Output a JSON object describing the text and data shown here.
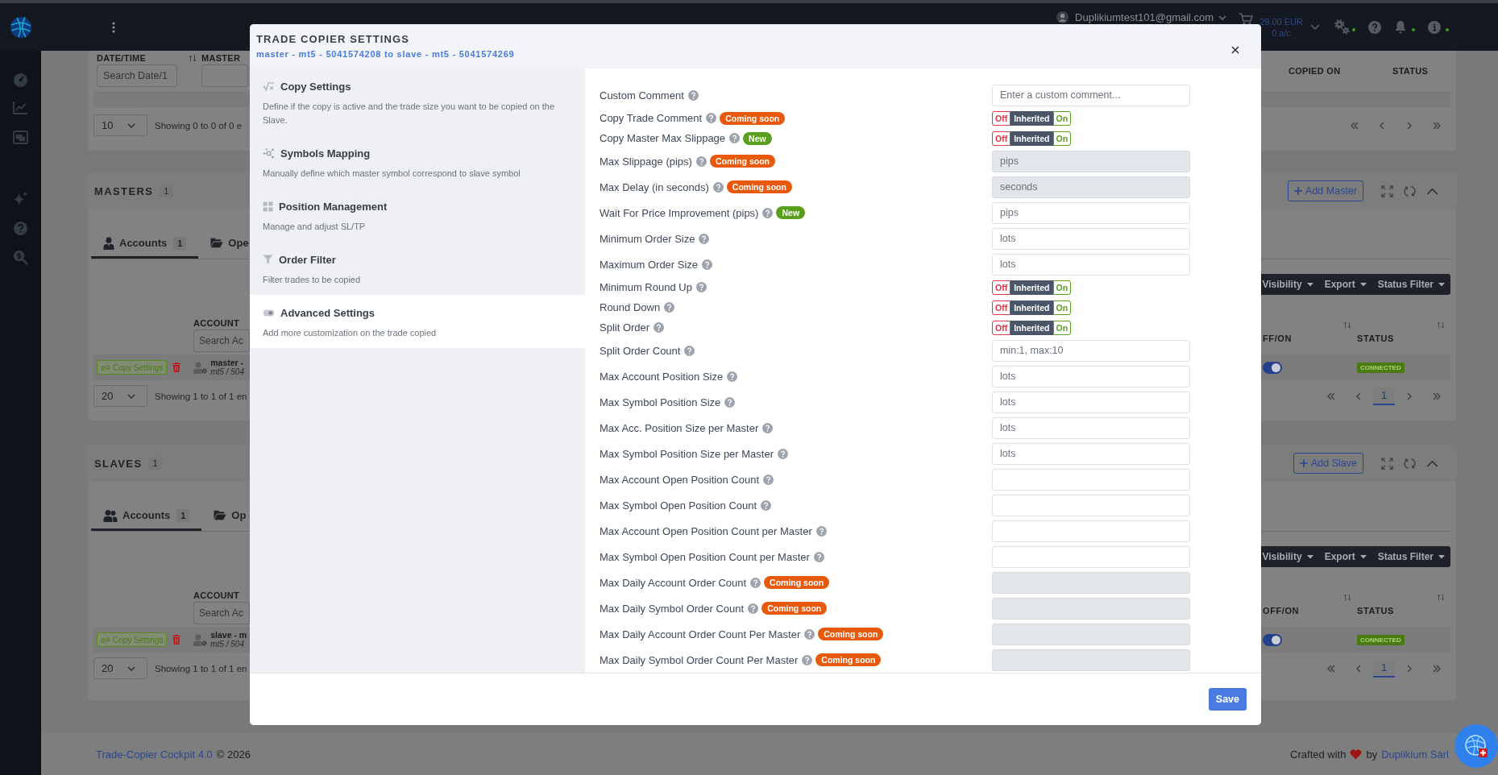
{
  "header": {
    "user_email": "Duplikiumtest101@gmail.com",
    "balance": "29.00 EUR",
    "accounts": "0 a/c"
  },
  "trades": {
    "columns": [
      {
        "label": "DATE/TIME",
        "sortable": true,
        "filter": true,
        "placeholder": "Search Date/1"
      },
      {
        "label": "MASTER",
        "sortable": false,
        "filter": true
      },
      {
        "label": "COPIED ON",
        "sortable": false,
        "filter": false
      },
      {
        "label": "STATUS",
        "sortable": false,
        "filter": false
      }
    ],
    "page_size": "10",
    "showing": "Showing 0 to 0 of 0 e"
  },
  "sections": [
    {
      "kind": "master",
      "title": "MASTERS",
      "count": "1",
      "add_button": "Add Master",
      "tabs": [
        {
          "label": "Accounts",
          "count": "1",
          "selected": true
        },
        {
          "label": "Ope",
          "selected": false
        }
      ],
      "toolbar": [
        "Visibility",
        "Export",
        "Status Filter"
      ],
      "columns": [
        {
          "label": "ACCOUNT",
          "sortable": false,
          "filter": true,
          "placeholder": "Search Ac"
        },
        {
          "label": "FF/ON",
          "sortable": true,
          "filter": false
        },
        {
          "label": "STATUS",
          "sortable": true,
          "filter": false
        }
      ],
      "rows": [
        {
          "action": "Copy Settings",
          "name": "master -",
          "detail": "mt5 / 504",
          "on": true,
          "status": "CONNECTED"
        }
      ],
      "page_size": "20",
      "showing": "Showing 1 to 1 of 1 en",
      "current_page": "1"
    },
    {
      "kind": "slave",
      "title": "SLAVES",
      "count": "1",
      "add_button": "Add Slave",
      "tabs": [
        {
          "label": "Accounts",
          "count": "1",
          "selected": true
        },
        {
          "label": "Op",
          "selected": false
        }
      ],
      "toolbar": [
        "Visibility",
        "Export",
        "Status Filter"
      ],
      "columns": [
        {
          "label": "ACCOUNT",
          "sortable": false,
          "filter": true,
          "placeholder": "Search Ac"
        },
        {
          "label": "OFF/ON",
          "sortable": true,
          "filter": false
        },
        {
          "label": "STATUS",
          "sortable": true,
          "filter": false
        }
      ],
      "rows": [
        {
          "action": "Copy Settings",
          "name": "slave - m",
          "detail": "mt5 / 504",
          "on": true,
          "status": "CONNECTED"
        }
      ],
      "page_size": "20",
      "showing": "Showing 1 to 1 of 1 en",
      "current_page": "1"
    }
  ],
  "footer": {
    "product": "Trade-Copier Cockpit 4.0",
    "copyright": "© 2026",
    "credit_prefix": "Crafted with",
    "credit_by": "by",
    "company": "Duplikium Sàrl"
  },
  "modal": {
    "title": "TRADE COPIER SETTINGS",
    "subtitle": "master - mt5 - 5041574208 to slave - mt5 - 5041574269",
    "nav": [
      {
        "title": "Copy Settings",
        "description": "Define if the copy is active and the trade size you want to be copied on the Slave.",
        "selected": false
      },
      {
        "title": "Symbols Mapping",
        "description": "Manually define which master symbol correspond to slave symbol",
        "selected": false
      },
      {
        "title": "Position Management",
        "description": "Manage and adjust SL/TP",
        "selected": false
      },
      {
        "title": "Order Filter",
        "description": "Filter trades to be copied",
        "selected": false
      },
      {
        "title": "Advanced Settings",
        "description": "Add more customization on the trade copied",
        "selected": true
      }
    ],
    "fields": [
      {
        "kind": "input",
        "label": "Custom Comment",
        "placeholder": "Enter a custom comment...",
        "disabled": false
      },
      {
        "kind": "toggle",
        "label": "Copy Trade Comment",
        "badge": {
          "text": "Coming soon",
          "color": "#e8590c"
        },
        "options": [
          {
            "label": "Off",
            "color": "#dc3545",
            "selected": false
          },
          {
            "label": "Inherited",
            "color": "#4a5568",
            "selected": true
          },
          {
            "label": "On",
            "color": "#5a9e1e",
            "selected": false
          }
        ]
      },
      {
        "kind": "toggle",
        "label": "Copy Master Max Slippage",
        "badge": {
          "text": "New",
          "color": "#5a9e1e"
        },
        "options": [
          {
            "label": "Off",
            "color": "#dc3545",
            "selected": false
          },
          {
            "label": "Inherited",
            "color": "#4a5568",
            "selected": true
          },
          {
            "label": "On",
            "color": "#5a9e1e",
            "selected": false
          }
        ]
      },
      {
        "kind": "input",
        "label": "Max Slippage (pips)",
        "badge": {
          "text": "Coming soon",
          "color": "#e8590c"
        },
        "placeholder": "pips",
        "disabled": true
      },
      {
        "kind": "input",
        "label": "Max Delay (in seconds)",
        "badge": {
          "text": "Coming soon",
          "color": "#e8590c"
        },
        "placeholder": "seconds",
        "disabled": true
      },
      {
        "kind": "input",
        "label": "Wait For Price Improvement (pips)",
        "badge": {
          "text": "New",
          "color": "#5a9e1e"
        },
        "placeholder": "pips",
        "disabled": false
      },
      {
        "kind": "input",
        "label": "Minimum Order Size",
        "placeholder": "lots",
        "disabled": false
      },
      {
        "kind": "input",
        "label": "Maximum Order Size",
        "placeholder": "lots",
        "disabled": false
      },
      {
        "kind": "toggle",
        "label": "Minimum Round Up",
        "options": [
          {
            "label": "Off",
            "color": "#dc3545",
            "selected": false
          },
          {
            "label": "Inherited",
            "color": "#4a5568",
            "selected": true
          },
          {
            "label": "On",
            "color": "#5a9e1e",
            "selected": false
          }
        ]
      },
      {
        "kind": "toggle",
        "label": "Round Down",
        "options": [
          {
            "label": "Off",
            "color": "#dc3545",
            "selected": false
          },
          {
            "label": "Inherited",
            "color": "#4a5568",
            "selected": true
          },
          {
            "label": "On",
            "color": "#5a9e1e",
            "selected": false
          }
        ]
      },
      {
        "kind": "toggle",
        "label": "Split Order",
        "options": [
          {
            "label": "Off",
            "color": "#dc3545",
            "selected": false
          },
          {
            "label": "Inherited",
            "color": "#4a5568",
            "selected": true
          },
          {
            "label": "On",
            "color": "#5a9e1e",
            "selected": false
          }
        ]
      },
      {
        "kind": "input",
        "label": "Split Order Count",
        "placeholder": "min:1, max:10",
        "disabled": false
      },
      {
        "kind": "input",
        "label": "Max Account Position Size",
        "placeholder": "lots",
        "disabled": false
      },
      {
        "kind": "input",
        "label": "Max Symbol Position Size",
        "placeholder": "lots",
        "disabled": false
      },
      {
        "kind": "input",
        "label": "Max Acc. Position Size per Master",
        "placeholder": "lots",
        "disabled": false
      },
      {
        "kind": "input",
        "label": "Max Symbol Position Size per Master",
        "placeholder": "lots",
        "disabled": false
      },
      {
        "kind": "input",
        "label": "Max Account Open Position Count",
        "disabled": false
      },
      {
        "kind": "input",
        "label": "Max Symbol Open Position Count",
        "disabled": false
      },
      {
        "kind": "input",
        "label": "Max Account Open Position Count per Master",
        "disabled": false
      },
      {
        "kind": "input",
        "label": "Max Symbol Open Position Count per Master",
        "disabled": false
      },
      {
        "kind": "input",
        "label": "Max Daily Account Order Count",
        "badge": {
          "text": "Coming soon",
          "color": "#e8590c"
        },
        "disabled": true
      },
      {
        "kind": "input",
        "label": "Max Daily Symbol Order Count",
        "badge": {
          "text": "Coming soon",
          "color": "#e8590c"
        },
        "disabled": true
      },
      {
        "kind": "input",
        "label": "Max Daily Account Order Count Per Master",
        "badge": {
          "text": "Coming soon",
          "color": "#e8590c"
        },
        "disabled": true
      },
      {
        "kind": "input",
        "label": "Max Daily Symbol Order Count Per Master",
        "badge": {
          "text": "Coming soon",
          "color": "#e8590c"
        },
        "disabled": true
      }
    ],
    "save": "Save"
  }
}
